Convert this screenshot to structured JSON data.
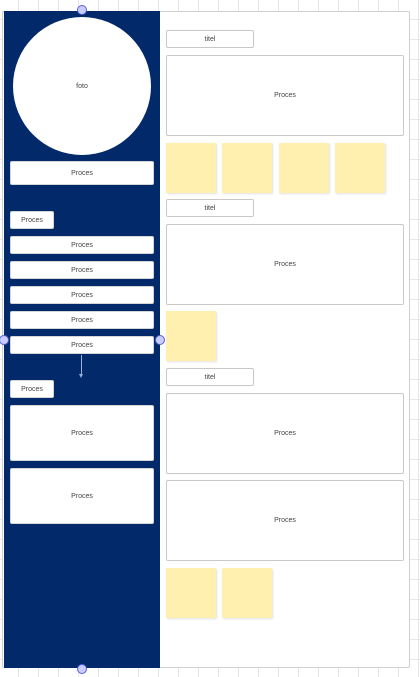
{
  "sidebar": {
    "photo_label": "foto",
    "process_boxes": [
      "Proces",
      "Proces",
      "Proces",
      "Proces",
      "Proces",
      "Proces",
      "Proces",
      "Proces",
      "Proces",
      "Proces"
    ]
  },
  "main": {
    "sections": [
      {
        "title": "titel",
        "boxes": [
          "Proces"
        ],
        "sticky_notes": 4
      },
      {
        "title": "titel",
        "boxes": [
          "Proces"
        ],
        "sticky_notes": 1
      },
      {
        "title": "titel",
        "boxes": [
          "Proces",
          "Proces"
        ],
        "sticky_notes": 2
      }
    ]
  },
  "colors": {
    "sidebar_bg": "#022a6b",
    "sticky_note": "#fff0b0",
    "selection_handle": "#c8ccff",
    "selection_handle_border": "#5660d8"
  }
}
